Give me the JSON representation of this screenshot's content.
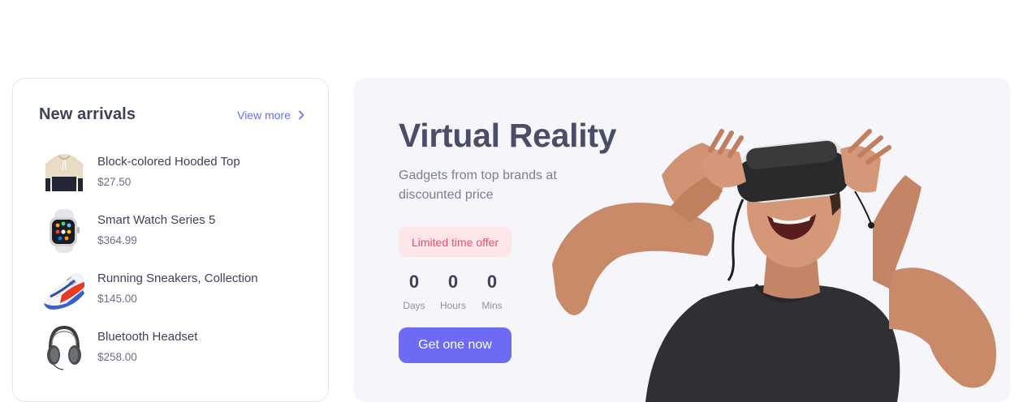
{
  "arrivals": {
    "title": "New arrivals",
    "view_more": "View more",
    "products": [
      {
        "name": "Block-colored Hooded Top",
        "price": "$27.50",
        "icon": "hoodie-icon"
      },
      {
        "name": "Smart Watch Series 5",
        "price": "$364.99",
        "icon": "smartwatch-icon"
      },
      {
        "name": "Running Sneakers, Collection",
        "price": "$145.00",
        "icon": "sneaker-icon"
      },
      {
        "name": "Bluetooth Headset",
        "price": "$258.00",
        "icon": "headphones-icon"
      }
    ]
  },
  "promo": {
    "title": "Virtual Reality",
    "subtitle": "Gadgets from top brands at discounted price",
    "badge": "Limited time offer",
    "countdown": [
      {
        "value": "0",
        "label": "Days"
      },
      {
        "value": "0",
        "label": "Hours"
      },
      {
        "value": "0",
        "label": "Mins"
      }
    ],
    "cta": "Get one now",
    "hero_image": "man-wearing-vr-headset"
  },
  "colors": {
    "accent": "#6d6af5",
    "link": "#6a6df7",
    "badge_bg": "#fde6ea",
    "badge_text": "#ef4d6f",
    "promo_bg": "#f6f6fa"
  }
}
